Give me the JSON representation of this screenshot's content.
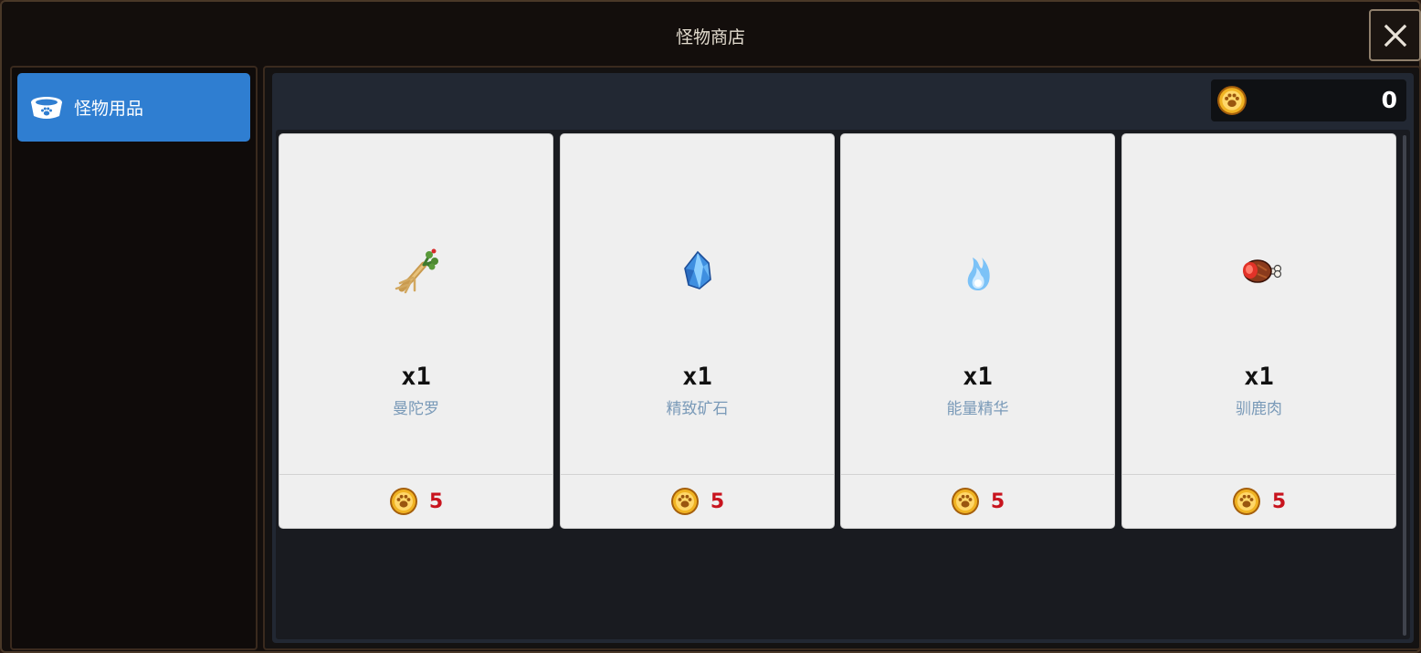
{
  "window": {
    "title": "怪物商店"
  },
  "sidebar": {
    "items": [
      {
        "label": "怪物用品",
        "icon": "pet-bowl-icon",
        "active": true
      }
    ]
  },
  "wallet": {
    "icon": "paw-coin-icon",
    "amount": "0"
  },
  "shop": {
    "items": [
      {
        "name": "曼陀罗",
        "quantity": "x1",
        "price": "5",
        "icon": "mandrake-root-icon"
      },
      {
        "name": "精致矿石",
        "quantity": "x1",
        "price": "5",
        "icon": "blue-crystal-icon"
      },
      {
        "name": "能量精华",
        "quantity": "x1",
        "price": "5",
        "icon": "blue-flame-icon"
      },
      {
        "name": "驯鹿肉",
        "quantity": "x1",
        "price": "5",
        "icon": "meat-icon"
      }
    ]
  },
  "colors": {
    "accent": "#2f7ed1",
    "price": "#c8141e",
    "item_name": "#7a9ab8",
    "coin": "#e9a21b"
  }
}
